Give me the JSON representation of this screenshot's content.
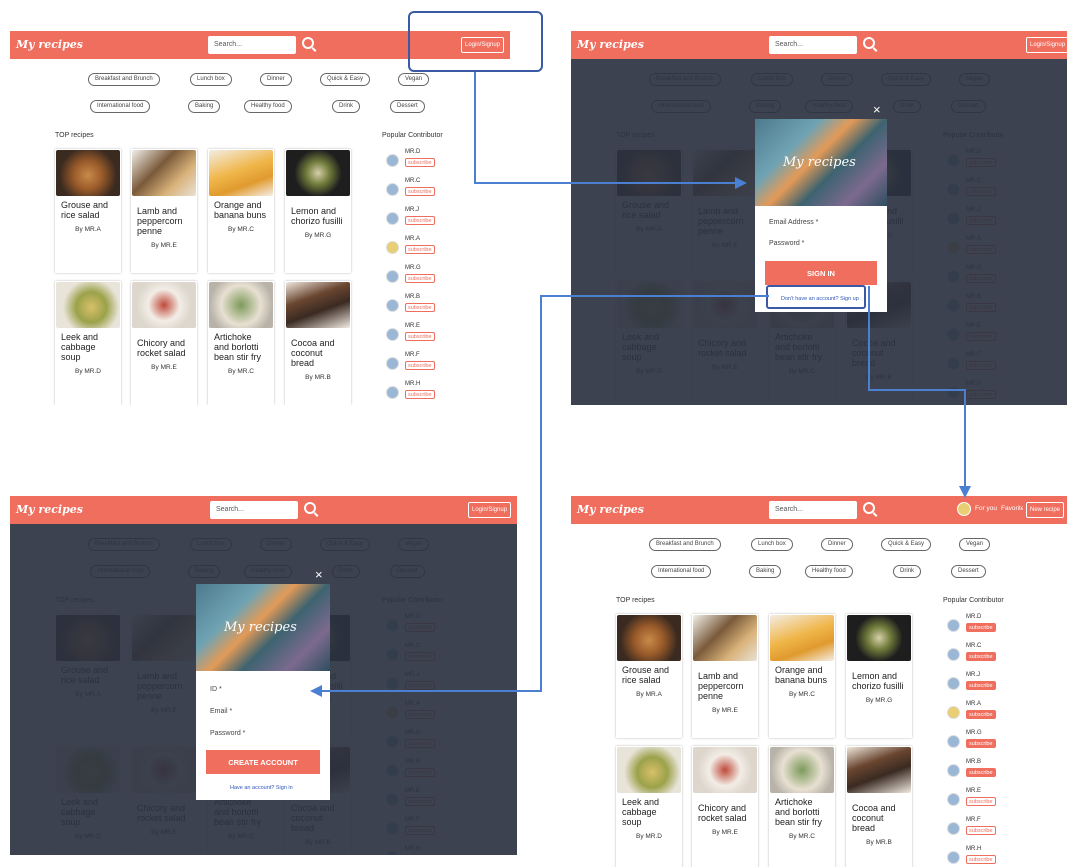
{
  "header": {
    "logo": "My recipes",
    "search_placeholder": "Search...",
    "login": "Login/Signup",
    "for_you": "For you",
    "favorite": "Favorite",
    "new_recipe": "New recipe"
  },
  "tags": [
    "Breakfast and Brunch",
    "Lunch box",
    "Dinner",
    "Quick & Easy",
    "Vegan",
    "International food",
    "Baking",
    "Healthy food",
    "Drink",
    "Dessert"
  ],
  "sections": {
    "top": "TOP recipes",
    "popular": "Popular Contributor"
  },
  "recipes": [
    {
      "title": "Grouse and rice salad",
      "by": "By MR.A"
    },
    {
      "title": "Lamb and peppercorn penne",
      "by": "By MR.E"
    },
    {
      "title": "Orange and banana buns",
      "by": "By MR.C"
    },
    {
      "title": "Lemon and chorizo fusilli",
      "by": "By MR.G"
    },
    {
      "title": "Leek and cabbage soup",
      "by": "By MR.D"
    },
    {
      "title": "Chicory and rocket salad",
      "by": "By MR.E"
    },
    {
      "title": "Artichoke and borlotti bean stir fry",
      "by": "By MR.C"
    },
    {
      "title": "Cocoa and coconut bread",
      "by": "By MR.B"
    }
  ],
  "contributors": [
    "MR.D",
    "MR.C",
    "MR.J",
    "MR.A",
    "MR.G",
    "MR.B",
    "MR.E",
    "MR.F",
    "MR.H"
  ],
  "subscribe": "subscribe",
  "signin": {
    "logo": "My recipes",
    "email": "Email Address *",
    "password": "Password *",
    "button": "SIGN IN",
    "link": "Don't have an account? Sign up",
    "close": "×"
  },
  "signup": {
    "logo": "My recipes",
    "id": "ID *",
    "email": "Email *",
    "password": "Password *",
    "button": "CREATE ACCOUNT",
    "link": "Have an account? Sign in",
    "close": "×"
  },
  "colors": {
    "brand": "#ef6e5e",
    "overlay": "#2b3240",
    "arrow": "#4a7fd1"
  }
}
